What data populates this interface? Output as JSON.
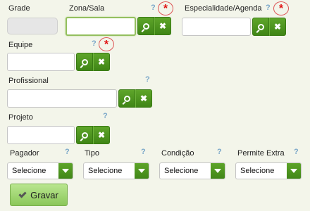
{
  "fields": {
    "grade": {
      "label": "Grade"
    },
    "zona_sala": {
      "label": "Zona/Sala"
    },
    "especialidade": {
      "label": "Especialidade/Agenda"
    },
    "equipe": {
      "label": "Equipe"
    },
    "profissional": {
      "label": "Profissional"
    },
    "projeto": {
      "label": "Projeto"
    }
  },
  "selects": {
    "pagador": {
      "label": "Pagador",
      "value": "Selecione"
    },
    "tipo": {
      "label": "Tipo",
      "value": "Selecione"
    },
    "condicao": {
      "label": "Condição",
      "value": "Selecione"
    },
    "permite_extra": {
      "label": "Permite Extra",
      "value": "Selecione"
    }
  },
  "common": {
    "help_mark": "?",
    "required_mark": "*",
    "clear_mark": "✖"
  },
  "actions": {
    "save_label": "Gravar"
  },
  "colors": {
    "accent": "#4c9520",
    "background": "#f3f5ea",
    "required": "#e01010",
    "help": "#7aa7c9"
  }
}
